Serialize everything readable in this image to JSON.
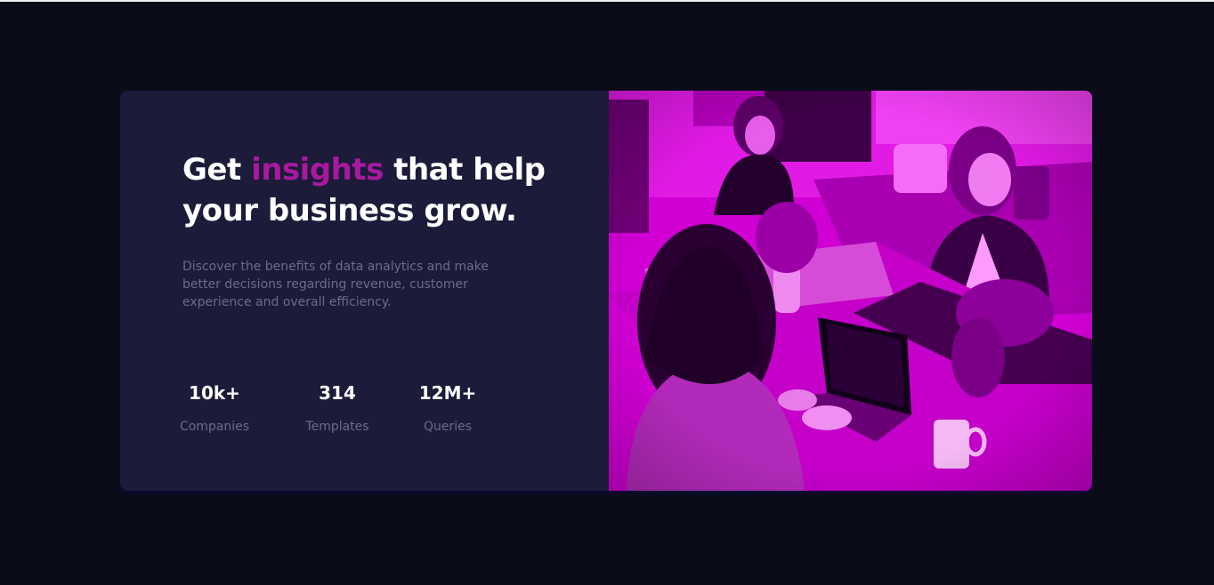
{
  "hero": {
    "headline_before": "Get ",
    "headline_accent": "insights",
    "headline_after": " that help your business grow.",
    "description": "Discover the benefits of data analytics and make better decisions regarding revenue, customer experience and overall efficiency."
  },
  "stats": [
    {
      "value": "10k+",
      "label": "Companies"
    },
    {
      "value": "314",
      "label": "Templates"
    },
    {
      "value": "12M+",
      "label": "Queries"
    }
  ],
  "image": {
    "description_icon": "office-team-photo",
    "tint_color": "#d100d6"
  },
  "colors": {
    "background": "#0a0c19",
    "card": "#1c1b3a",
    "accent": "#a8199e",
    "muted_text": "#6d6c86"
  }
}
